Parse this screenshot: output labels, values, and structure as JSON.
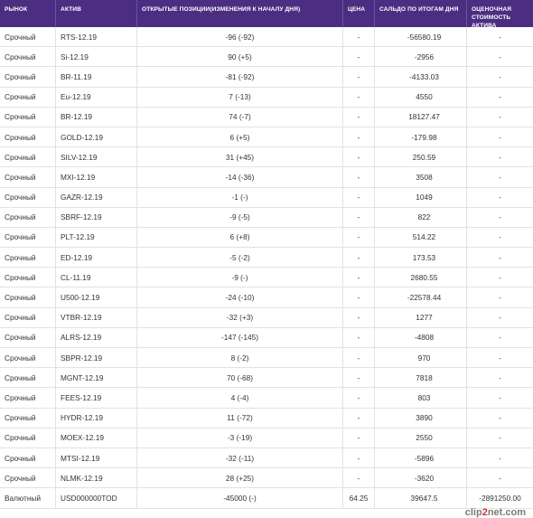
{
  "header": {
    "market": "РЫНОК",
    "asset": "АКТИВ",
    "positions": "ОТКРЫТЫЕ ПОЗИЦИИ(ИЗМЕНЕНИЯ К НАЧАЛУ ДНЯ)",
    "price": "ЦЕНА",
    "balance": "САЛЬДО ПО ИТОГАМ ДНЯ",
    "valuation": "ОЦЕНОЧНАЯ СТОИМОСТЬ АКТИВА"
  },
  "rows": [
    {
      "market": "Срочный",
      "asset": "RTS-12.19",
      "positions": "-96 (-92)",
      "price": "-",
      "balance": "-56580.19",
      "valuation": "-"
    },
    {
      "market": "Срочный",
      "asset": "Si-12.19",
      "positions": "90 (+5)",
      "price": "-",
      "balance": "-2956",
      "valuation": "-"
    },
    {
      "market": "Срочный",
      "asset": "BR-11.19",
      "positions": "-81 (-92)",
      "price": "-",
      "balance": "-4133.03",
      "valuation": "-"
    },
    {
      "market": "Срочный",
      "asset": "Eu-12.19",
      "positions": "7 (-13)",
      "price": "-",
      "balance": "4550",
      "valuation": "-"
    },
    {
      "market": "Срочный",
      "asset": "BR-12.19",
      "positions": "74 (-7)",
      "price": "-",
      "balance": "18127.47",
      "valuation": "-"
    },
    {
      "market": "Срочный",
      "asset": "GOLD-12.19",
      "positions": "6 (+5)",
      "price": "-",
      "balance": "-179.98",
      "valuation": "-"
    },
    {
      "market": "Срочный",
      "asset": "SILV-12.19",
      "positions": "31 (+45)",
      "price": "-",
      "balance": "250.59",
      "valuation": "-"
    },
    {
      "market": "Срочный",
      "asset": "MXI-12.19",
      "positions": "-14 (-36)",
      "price": "-",
      "balance": "3508",
      "valuation": "-"
    },
    {
      "market": "Срочный",
      "asset": "GAZR-12.19",
      "positions": "-1 (-)",
      "price": "-",
      "balance": "1049",
      "valuation": "-"
    },
    {
      "market": "Срочный",
      "asset": "SBRF-12.19",
      "positions": "-9 (-5)",
      "price": "-",
      "balance": "822",
      "valuation": "-"
    },
    {
      "market": "Срочный",
      "asset": "PLT-12.19",
      "positions": "6 (+8)",
      "price": "-",
      "balance": "514.22",
      "valuation": "-"
    },
    {
      "market": "Срочный",
      "asset": "ED-12.19",
      "positions": "-5 (-2)",
      "price": "-",
      "balance": "173.53",
      "valuation": "-"
    },
    {
      "market": "Срочный",
      "asset": "CL-11.19",
      "positions": "-9 (-)",
      "price": "-",
      "balance": "2680.55",
      "valuation": "-"
    },
    {
      "market": "Срочный",
      "asset": "U500-12.19",
      "positions": "-24 (-10)",
      "price": "-",
      "balance": "-22578.44",
      "valuation": "-"
    },
    {
      "market": "Срочный",
      "asset": "VTBR-12.19",
      "positions": "-32 (+3)",
      "price": "-",
      "balance": "1277",
      "valuation": "-"
    },
    {
      "market": "Срочный",
      "asset": "ALRS-12.19",
      "positions": "-147 (-145)",
      "price": "-",
      "balance": "-4808",
      "valuation": "-"
    },
    {
      "market": "Срочный",
      "asset": "SBPR-12.19",
      "positions": "8 (-2)",
      "price": "-",
      "balance": "970",
      "valuation": "-"
    },
    {
      "market": "Срочный",
      "asset": "MGNT-12.19",
      "positions": "70 (-68)",
      "price": "-",
      "balance": "7818",
      "valuation": "-"
    },
    {
      "market": "Срочный",
      "asset": "FEES-12.19",
      "positions": "4 (-4)",
      "price": "-",
      "balance": "803",
      "valuation": "-"
    },
    {
      "market": "Срочный",
      "asset": "HYDR-12.19",
      "positions": "11 (-72)",
      "price": "-",
      "balance": "3890",
      "valuation": "-"
    },
    {
      "market": "Срочный",
      "asset": "MOEX-12.19",
      "positions": "-3 (-19)",
      "price": "-",
      "balance": "2550",
      "valuation": "-"
    },
    {
      "market": "Срочный",
      "asset": "MTSI-12.19",
      "positions": "-32 (-11)",
      "price": "-",
      "balance": "-5896",
      "valuation": "-"
    },
    {
      "market": "Срочный",
      "asset": "NLMK-12.19",
      "positions": "28 (+25)",
      "price": "-",
      "balance": "-3620",
      "valuation": "-"
    },
    {
      "market": "Валютный",
      "asset": "USD000000TOD",
      "positions": "-45000 (-)",
      "price": "64.25",
      "balance": "39647.5",
      "valuation": "-2891250.00"
    }
  ],
  "watermark": {
    "part1": "clip",
    "part2": "2",
    "part3": "net.com"
  },
  "colors": {
    "header_bg": "#4b2e82",
    "header_text": "#ffffff",
    "border": "#e2e2e2"
  }
}
